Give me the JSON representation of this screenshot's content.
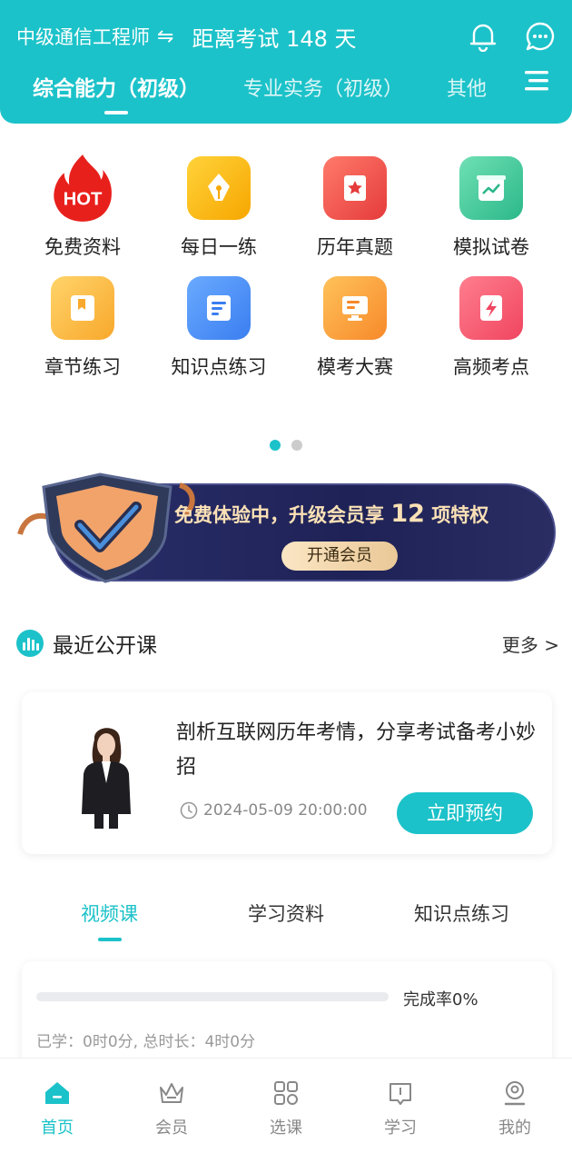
{
  "header": {
    "exam_name": "中级通信工程师",
    "swap_symbol": "⇋",
    "countdown": "距离考试 148 天",
    "tabs": [
      {
        "label": "综合能力（初级）",
        "active": true
      },
      {
        "label": "专业实务（初级）",
        "active": false
      },
      {
        "label": "其他",
        "active": false
      }
    ],
    "icons": [
      "bell-icon",
      "chat-icon",
      "menu-icon"
    ]
  },
  "grid": {
    "items": [
      {
        "label": "免费资料",
        "icon": "hot-fire-icon"
      },
      {
        "label": "每日一练",
        "icon": "pen-nib-icon"
      },
      {
        "label": "历年真题",
        "icon": "star-book-icon"
      },
      {
        "label": "模拟试卷",
        "icon": "chart-paper-icon"
      },
      {
        "label": "章节练习",
        "icon": "bookmark-icon"
      },
      {
        "label": "知识点练习",
        "icon": "document-icon"
      },
      {
        "label": "模考大赛",
        "icon": "monitor-icon"
      },
      {
        "label": "高频考点",
        "icon": "lightning-icon"
      }
    ],
    "hot_text": "HOT",
    "page_count": 2,
    "active_page": 1
  },
  "banner": {
    "text_prefix": "免费体验中，升级会员享 ",
    "text_number": "12",
    "text_suffix": " 项特权",
    "button_label": "开通会员",
    "icon": "shield-check-icon"
  },
  "section": {
    "title": "最近公开课",
    "more_label": "更多 >",
    "icon": "bar-chart-icon"
  },
  "course": {
    "title": "剖析互联网历年考情，分享考试备考小妙招",
    "time": "2024-05-09 20:00:00",
    "button_label": "立即预约",
    "icons": [
      "teacher-avatar",
      "clock-icon"
    ]
  },
  "sub_tabs": [
    {
      "label": "视频课",
      "active": true
    },
    {
      "label": "学习资料",
      "active": false
    },
    {
      "label": "知识点练习",
      "active": false
    }
  ],
  "progress": {
    "completion_label": "完成率0%",
    "completion": 0,
    "info": "已学：0时0分, 总时长：4时0分"
  },
  "bottom_nav": [
    {
      "label": "首页",
      "icon": "home-icon",
      "active": true
    },
    {
      "label": "会员",
      "icon": "crown-icon",
      "active": false
    },
    {
      "label": "选课",
      "icon": "grid-icon",
      "active": false
    },
    {
      "label": "学习",
      "icon": "book-icon",
      "active": false
    },
    {
      "label": "我的",
      "icon": "user-icon",
      "active": false
    }
  ],
  "colors": {
    "accent": "#1cc2c9",
    "banner_bg": "#1e2256",
    "banner_gold": "#fbe1b6"
  }
}
